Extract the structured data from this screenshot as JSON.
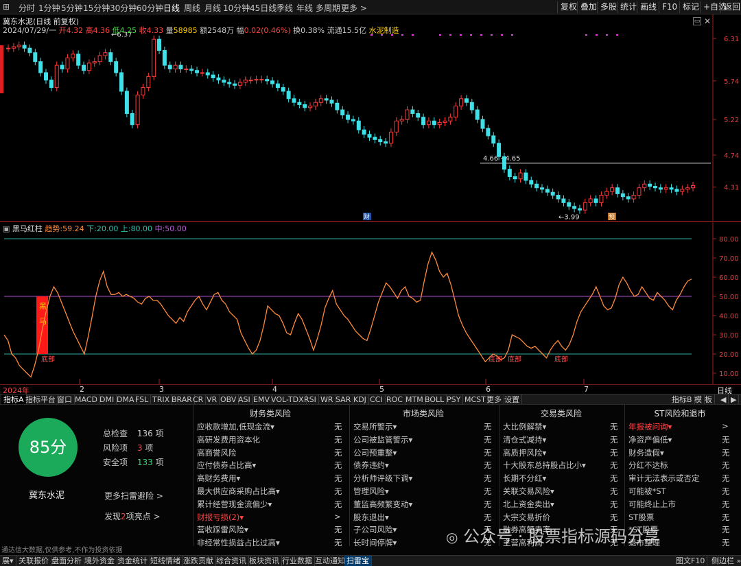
{
  "period_bar": {
    "periods": [
      "分时",
      "1分钟",
      "5分钟",
      "15分钟",
      "30分钟",
      "60分钟",
      "日线",
      "周线",
      "月线",
      "10分钟",
      "45日线",
      "季线",
      "年线",
      "多周期",
      "更多 >"
    ],
    "right_buttons": [
      "复权",
      "叠加",
      "多股",
      "统计",
      "画线",
      "F10",
      "标记",
      "+自选",
      "返回"
    ]
  },
  "stock": {
    "title": "冀东水泥(日线 前复权)",
    "date": "2024/07/29/一",
    "open_label": "开",
    "open": "4.32",
    "high_label": "高",
    "high": "4.36",
    "low_label": "低",
    "low": "4.25",
    "close_label": "收",
    "close": "4.33",
    "volume_label": "量",
    "volume": "58985",
    "amount_label": "额",
    "amount": "2548万",
    "change_label": "幅",
    "change": "0.02(0.46%)",
    "turnover_label": "换",
    "turnover": "0.38%",
    "float_label": "流通",
    "float": "15.5亿",
    "industry": "水泥制造"
  },
  "price_axis": [
    "6.31",
    "5.74",
    "5.22",
    "4.74",
    "4.31"
  ],
  "annotations": {
    "high_mark": "6.37",
    "low_mark": "3.99",
    "range_mark": "4.66 - 4.65",
    "badge_cai": "财",
    "badge_yu": "预"
  },
  "indicator": {
    "name": "黑马红柱",
    "trend_label": "趋势:",
    "trend": "59.24",
    "low_label": "下:",
    "low": "20.00",
    "up_label": "上:",
    "up": "80.00",
    "mid_label": "中:",
    "mid": "50.00",
    "axis": [
      "80.00",
      "70.00",
      "60.00",
      "50.00",
      "40.00",
      "30.00",
      "20.00",
      "10.00"
    ],
    "heima_label": "黑马",
    "bottom_label": "底部",
    "series": [
      30,
      27,
      20,
      18,
      14,
      12,
      10,
      8,
      14,
      22,
      33,
      42,
      50,
      55,
      52,
      47,
      42,
      37,
      32,
      28,
      24,
      20,
      29,
      39,
      50,
      58,
      63,
      55,
      51,
      51,
      52,
      50,
      51,
      50,
      49,
      47,
      46,
      49,
      50,
      48,
      48,
      46,
      43,
      40,
      38,
      36,
      39,
      37,
      42,
      45,
      48,
      50,
      46,
      43,
      47,
      51,
      52,
      48,
      46,
      42,
      40,
      38,
      31,
      27,
      23,
      20,
      22,
      27,
      35,
      45,
      43,
      41,
      40,
      36,
      31,
      30,
      36,
      41,
      38,
      33,
      28,
      22,
      28,
      35,
      44,
      49,
      53,
      46,
      43,
      40,
      38,
      35,
      32,
      30,
      28,
      27,
      33,
      40,
      47,
      52,
      57,
      55,
      52,
      49,
      53,
      55,
      50,
      49,
      47,
      48,
      58,
      67,
      73,
      69,
      63,
      60,
      62,
      56,
      48,
      40,
      35,
      31,
      28,
      25,
      22,
      19,
      16,
      18,
      20,
      19,
      17,
      18,
      22,
      30,
      29,
      28,
      26,
      24,
      23,
      24,
      22,
      20,
      18,
      22,
      25,
      27,
      24,
      22,
      25,
      30,
      37,
      42,
      45,
      48,
      51,
      55,
      50,
      45,
      43,
      44,
      49,
      56,
      60,
      57,
      53,
      50,
      51,
      55,
      52,
      49,
      48,
      52,
      50,
      48,
      45,
      43,
      48,
      51,
      55,
      58,
      59
    ]
  },
  "time_axis": {
    "year": "2024年",
    "months": [
      "2",
      "3",
      "4",
      "5",
      "6",
      "7"
    ],
    "period": "日线"
  },
  "indicator_tabs": [
    "指标A",
    "指标平台",
    "窗口",
    "MACD",
    "DMI",
    "DMA",
    "FSL",
    "TRIX",
    "BRAR",
    "CR",
    "VR",
    "OBV",
    "ASI",
    "EMV",
    "VOL-TDX",
    "RSI",
    "WR",
    "SAR",
    "KDJ",
    "CCI",
    "ROC",
    "MTM",
    "BOLL",
    "PSY",
    "MCST",
    "更多",
    "设置"
  ],
  "indicator_tabs_right": [
    "指标B",
    "模",
    "板"
  ],
  "risk_panel": {
    "score": "85分",
    "total_label": "总检查",
    "total": "136",
    "total_unit": "项",
    "risk_label": "风险项",
    "risk": "3",
    "risk_unit": "项",
    "safe_label": "安全项",
    "safe": "133",
    "safe_unit": "项",
    "stock_name": "冀东水泥",
    "more_scan": "更多扫雷避险 >",
    "find_prefix": "发现",
    "find_count": "2",
    "find_suffix": "项亮点 >",
    "columns": [
      {
        "title": "财务类风险",
        "items": [
          {
            "label": "应收款增加,低现金流▾",
            "value": "无",
            "red": false
          },
          {
            "label": "高研发费用资本化",
            "value": "无",
            "red": false
          },
          {
            "label": "高商誉风险",
            "value": "无",
            "red": false
          },
          {
            "label": "应付债券占比高▾",
            "value": "无",
            "red": false
          },
          {
            "label": "高财务费用▾",
            "value": "无",
            "red": false
          },
          {
            "label": "最大供应商采购占比高▾",
            "value": "无",
            "red": false
          },
          {
            "label": "累计经营现金流偏少▾",
            "value": "无",
            "red": false
          },
          {
            "label": "财报亏损(2)▾",
            "value": ">",
            "red": true
          },
          {
            "label": "营收踩雷风险▾",
            "value": "无",
            "red": false
          },
          {
            "label": "非经常性损益占比过高▾",
            "value": "无",
            "red": false
          }
        ]
      },
      {
        "title": "市场类风险",
        "items": [
          {
            "label": "交易所警示▾",
            "value": "无",
            "red": false
          },
          {
            "label": "公司被监管警示▾",
            "value": "无",
            "red": false
          },
          {
            "label": "公司预重整▾",
            "value": "无",
            "red": false
          },
          {
            "label": "债券违约▾",
            "value": "无",
            "red": false
          },
          {
            "label": "分析师评级下调▾",
            "value": "无",
            "red": false
          },
          {
            "label": "管理风险▾",
            "value": "无",
            "red": false
          },
          {
            "label": "董监高频繁变动▾",
            "value": "无",
            "red": false
          },
          {
            "label": "股东退出▾",
            "value": "无",
            "red": false
          },
          {
            "label": "子公司风险▾",
            "value": "无",
            "red": false
          },
          {
            "label": "长时间停牌▾",
            "value": "无",
            "red": false
          }
        ]
      },
      {
        "title": "交易类风险",
        "items": [
          {
            "label": "大比例解禁▾",
            "value": "无",
            "red": false
          },
          {
            "label": "清仓式减持▾",
            "value": "无",
            "red": false
          },
          {
            "label": "高质押风险▾",
            "value": "无",
            "red": false
          },
          {
            "label": "十大股东总持股占比小▾",
            "value": "无",
            "red": false
          },
          {
            "label": "长期不分红▾",
            "value": "无",
            "red": false
          },
          {
            "label": "关联交易风险▾",
            "value": "无",
            "red": false
          },
          {
            "label": "北上资金卖出▾",
            "value": "无",
            "red": false
          },
          {
            "label": "大宗交易折价",
            "value": "无",
            "red": false
          },
          {
            "label": "融券高额卖率",
            "value": "无",
            "red": false
          },
          {
            "label": "主营高利润",
            "value": "无",
            "red": false
          }
        ]
      },
      {
        "title": "ST风险和退市",
        "items": [
          {
            "label": "年报被问询▾",
            "value": ">",
            "red": true
          },
          {
            "label": "净资产偏低▾",
            "value": "无",
            "red": false
          },
          {
            "label": "财务造假▾",
            "value": "无",
            "red": false
          },
          {
            "label": "分红不达标",
            "value": "无",
            "red": false
          },
          {
            "label": "审计无法表示或否定",
            "value": "无",
            "red": false
          },
          {
            "label": "可能被*ST",
            "value": "无",
            "red": false
          },
          {
            "label": "可能终止上市",
            "value": "无",
            "red": false
          },
          {
            "label": "ST股票",
            "value": "无",
            "red": false
          },
          {
            "label": "*ST股票",
            "value": "无",
            "red": false
          },
          {
            "label": "退市整理",
            "value": "无",
            "red": false
          }
        ]
      }
    ],
    "disclaimer": "通达信大数据,仅供参考,不作为投资依据",
    "watermark": "公众号 · 股票指标源码分享"
  },
  "status_tabs": [
    "展▾",
    "关联报价",
    "盘面分析",
    "境外资金",
    "资金统计",
    "短线情绪",
    "涨跌贡献",
    "综合资讯",
    "板块资讯",
    "行业数据",
    "互动通知",
    "扫雷宝"
  ],
  "status_right": [
    "图文F10",
    "侧边栏 »"
  ],
  "colors": {
    "up": "#ff3b3b",
    "down": "#3fe0e8",
    "trend_line": "#ff8a3c",
    "mid_line": "#b050d0",
    "band_line": "#30b0a0",
    "score_green": "#1aaa5a"
  }
}
